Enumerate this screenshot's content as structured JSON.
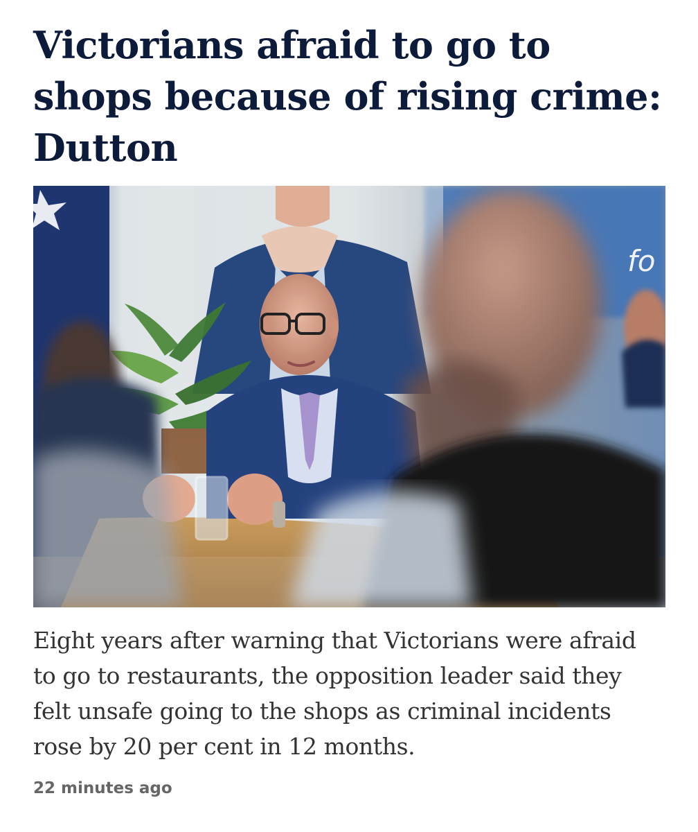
{
  "article": {
    "headline": "Victorians afraid to go to shops because of rising crime: Dutton",
    "summary": "Eight years after warning that Victorians were afraid to go to restaurants, the opposition leader said they felt unsafe going to the shops as criminal incidents rose by 20 per cent in 12 months.",
    "timestamp": "22 minutes ago",
    "photo": {
      "alt": "Opposition leader in a blue suit and glasses gesturing while speaking at a table, with blurred people in the foreground",
      "background_text": "fo"
    }
  },
  "colors": {
    "headline": "#0d1b3a",
    "summary": "#333333",
    "timestamp": "#666666"
  }
}
